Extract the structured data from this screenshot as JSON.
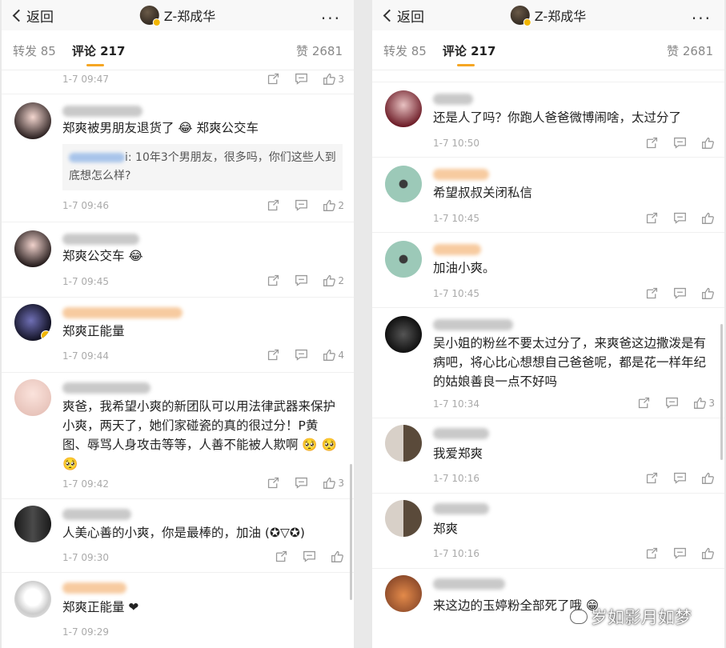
{
  "left": {
    "back_label": "返回",
    "title": "Z-郑成华",
    "more": "...",
    "tabs": {
      "reposts": "转发 85",
      "comments": "评论 217",
      "likes": "赞 2681"
    },
    "top_time": "1-7 09:47",
    "top_likes": "3",
    "comments": [
      {
        "text": "郑爽被男朋友退货了 😂 郑爽公交车",
        "reply": "i: 10年3个男朋友，很多吗，你们这些人到底想怎么样?",
        "time": "1-7 09:46",
        "likes": "2"
      },
      {
        "text": "郑爽公交车 😂",
        "time": "1-7 09:45",
        "likes": "2"
      },
      {
        "text": "郑爽正能量",
        "time": "1-7 09:44",
        "likes": "4"
      },
      {
        "text": "爽爸，我希望小爽的新团队可以用法律武器来保护小爽，两天了，她们家碰瓷的真的很过分！P黄图、辱骂人身攻击等等，人善不能被人欺啊 🥺 🥺 🥺",
        "time": "1-7 09:42",
        "likes": "3"
      },
      {
        "text": "人美心善的小爽，你是最棒的，加油 (✪▽✪)",
        "time": "1-7 09:30",
        "likes": ""
      },
      {
        "text": "郑爽正能量 ❤",
        "time": "1-7 09:29",
        "likes": ""
      }
    ]
  },
  "right": {
    "back_label": "返回",
    "title": "Z-郑成华",
    "more": "...",
    "tabs": {
      "reposts": "转发 85",
      "comments": "评论 217",
      "likes": "赞 2681"
    },
    "comments": [
      {
        "text": "还是人了吗？你跑人爸爸微博闹啥，太过分了",
        "time": "1-7 10:50",
        "likes": ""
      },
      {
        "text": "希望叔叔关闭私信",
        "time": "1-7 10:45",
        "likes": ""
      },
      {
        "text": "加油小爽。",
        "time": "1-7 10:45",
        "likes": ""
      },
      {
        "text": "吴小姐的粉丝不要太过分了，来爽爸这边撒泼是有病吧，将心比心想想自己爸爸呢，都是花一样年纪的姑娘善良一点不好吗",
        "time": "1-7 10:34",
        "likes": "3"
      },
      {
        "text": "我爱郑爽",
        "time": "1-7 10:16",
        "likes": ""
      },
      {
        "text": "郑爽",
        "time": "1-7 10:16",
        "likes": ""
      },
      {
        "text": "来这边的玉婷粉全部死了哦 😁",
        "time": "",
        "likes": ""
      }
    ]
  },
  "watermark": "岁如影月如梦",
  "icon_names": [
    "back-chevron-icon",
    "more-icon",
    "repost-icon",
    "comment-icon",
    "like-icon"
  ]
}
